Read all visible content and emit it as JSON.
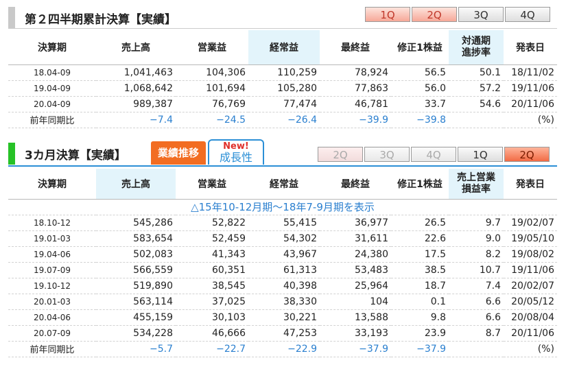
{
  "sec1": {
    "title": "第２四半期累計決算【実績】",
    "qbuttons": [
      "1Q",
      "2Q",
      "3Q",
      "4Q"
    ],
    "headers": [
      "決算期",
      "売上高",
      "営業益",
      "経常益",
      "最終益",
      "修正1株益",
      "対通期\n進捗率",
      "発表日"
    ],
    "rows": [
      [
        "18.04-09",
        "1,041,463",
        "104,306",
        "110,259",
        "78,924",
        "56.5",
        "50.1",
        "18/11/02"
      ],
      [
        "19.04-09",
        "1,068,642",
        "101,694",
        "105,280",
        "77,863",
        "56.0",
        "57.2",
        "19/11/06"
      ],
      [
        "20.04-09",
        "989,387",
        "76,769",
        "77,474",
        "46,781",
        "33.7",
        "54.6",
        "20/11/06"
      ]
    ],
    "yoy": [
      "前年同期比",
      "−7.4",
      "−24.5",
      "−26.4",
      "−39.9",
      "−39.8",
      "",
      "(%)"
    ]
  },
  "sec2": {
    "title": "3カ月決算【実績】",
    "tab_perf": "業績推移",
    "tab_new_badge": "New!",
    "tab_new_label": "成長性",
    "qbuttons": [
      "2Q",
      "3Q",
      "4Q",
      "1Q",
      "2Q"
    ],
    "headers": [
      "決算期",
      "売上高",
      "営業益",
      "経常益",
      "最終益",
      "修正1株益",
      "売上営業\n損益率",
      "発表日"
    ],
    "show_link": "△15年10-12月期～18年7-9月期を表示",
    "rows": [
      [
        "18.10-12",
        "545,286",
        "52,822",
        "55,415",
        "36,977",
        "26.5",
        "9.7",
        "19/02/07"
      ],
      [
        "19.01-03",
        "583,654",
        "52,459",
        "54,302",
        "31,611",
        "22.6",
        "9.0",
        "19/05/10"
      ],
      [
        "19.04-06",
        "502,083",
        "41,343",
        "43,967",
        "24,380",
        "17.5",
        "8.2",
        "19/08/02"
      ],
      [
        "19.07-09",
        "566,559",
        "60,351",
        "61,313",
        "53,483",
        "38.5",
        "10.7",
        "19/11/06"
      ],
      [
        "19.10-12",
        "519,890",
        "38,545",
        "40,398",
        "25,964",
        "18.7",
        "7.4",
        "20/02/07"
      ],
      [
        "20.01-03",
        "563,114",
        "37,025",
        "38,330",
        "104",
        "0.1",
        "6.6",
        "20/05/12"
      ],
      [
        "20.04-06",
        "455,159",
        "30,103",
        "30,221",
        "13,588",
        "9.8",
        "6.6",
        "20/08/04"
      ],
      [
        "20.07-09",
        "534,228",
        "46,666",
        "47,253",
        "33,193",
        "23.9",
        "8.7",
        "20/11/06"
      ]
    ],
    "yoy": [
      "前年同期比",
      "−5.7",
      "−22.7",
      "−22.9",
      "−37.9",
      "−37.9",
      "",
      "(%)"
    ]
  }
}
